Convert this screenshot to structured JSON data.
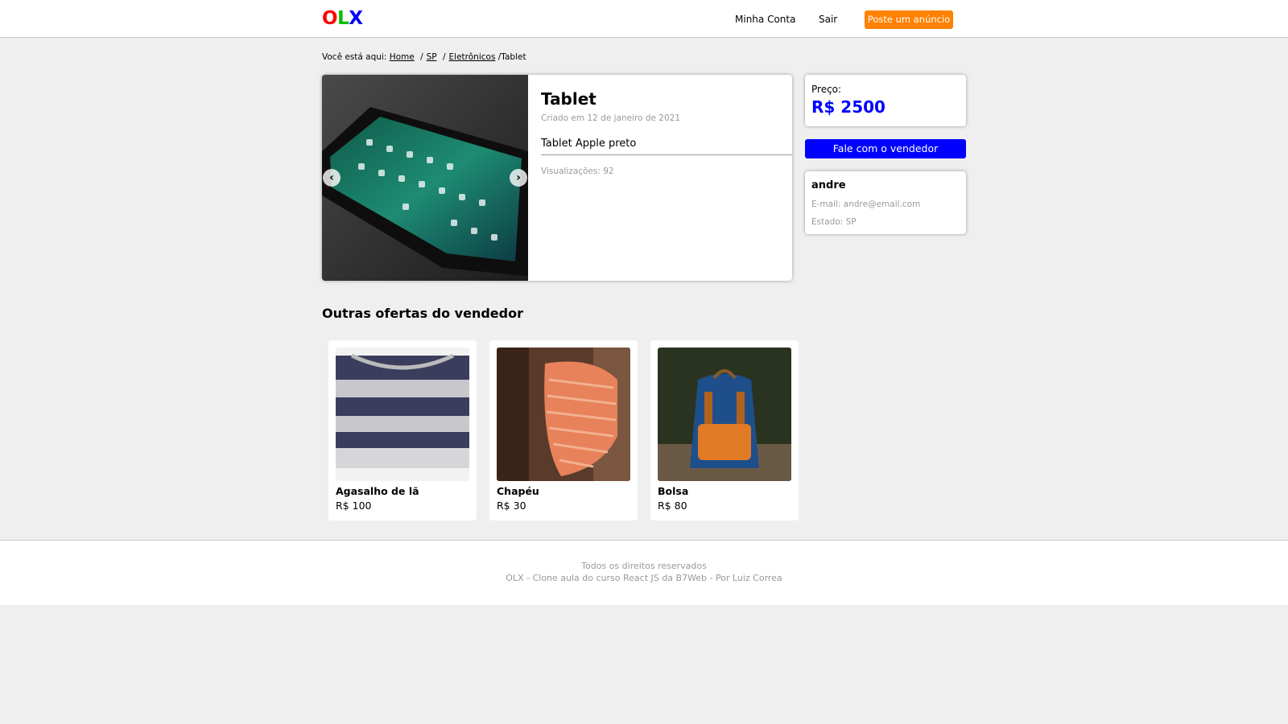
{
  "header": {
    "logo": {
      "o": "O",
      "l": "L",
      "x": "X"
    },
    "nav": {
      "account": "Minha Conta",
      "logout": "Sair",
      "post_ad": "Poste um anúncio"
    },
    "colors": {
      "post_ad_bg": "#ff8100"
    }
  },
  "breadcrumb": {
    "prefix": "Você está aqui:",
    "home": "Home",
    "state": "SP",
    "category": "Eletrônicos",
    "current": "/Tablet"
  },
  "product": {
    "title": "Tablet",
    "created": "Criado em 12 de janeiro de 2021",
    "description": "Tablet Apple preto",
    "views": "Visualizações: 92",
    "photo_icon": "tablet-photo",
    "prev_icon": "chevron-left-icon",
    "next_icon": "chevron-right-icon"
  },
  "price": {
    "label": "Preço:",
    "value": "R$ 2500",
    "color": "#0000ff"
  },
  "contact_button": "Fale com o vendedor",
  "seller": {
    "name": "andre",
    "email": "E-mail: andre@email.com",
    "state": "Estado: SP"
  },
  "others": {
    "title": "Outras ofertas do vendedor",
    "items": [
      {
        "title": "Agasalho de lã",
        "price": "R$ 100",
        "image": "sweater-photo"
      },
      {
        "title": "Chapéu",
        "price": "R$ 30",
        "image": "hat-photo"
      },
      {
        "title": "Bolsa",
        "price": "R$ 80",
        "image": "backpack-photo"
      }
    ]
  },
  "footer": {
    "line1": "Todos os direitos reservados",
    "line2": "OLX - Clone aula do curso React JS da B7Web - Por Luiz Correa"
  }
}
